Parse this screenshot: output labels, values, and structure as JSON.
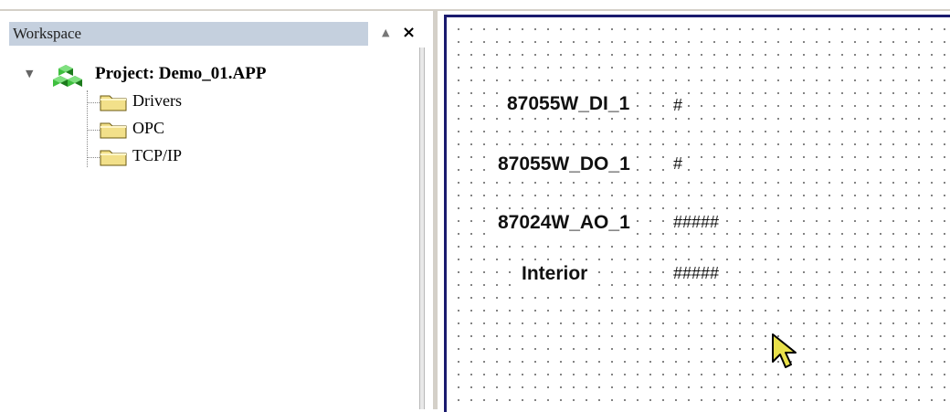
{
  "workspace": {
    "title": "Workspace",
    "up_glyph": "▲",
    "close_glyph": "×",
    "tree": {
      "expander_glyph": "▼",
      "root_label": "Project: Demo_01.APP",
      "children": [
        {
          "label": "Drivers"
        },
        {
          "label": "OPC"
        },
        {
          "label": "TCP/IP"
        }
      ]
    }
  },
  "canvas": {
    "tags": [
      {
        "name": "87055W_DI_1",
        "value": "#"
      },
      {
        "name": "87055W_DO_1",
        "value": "#"
      },
      {
        "name": "87024W_AO_1",
        "value": "#####"
      },
      {
        "name": "Interior",
        "value": "#####"
      }
    ]
  },
  "colors": {
    "header_bg": "#c5d0de",
    "canvas_border": "#1a1a6e",
    "folder_fill": "#f2e08a",
    "cursor_fill": "#e8e04a"
  }
}
